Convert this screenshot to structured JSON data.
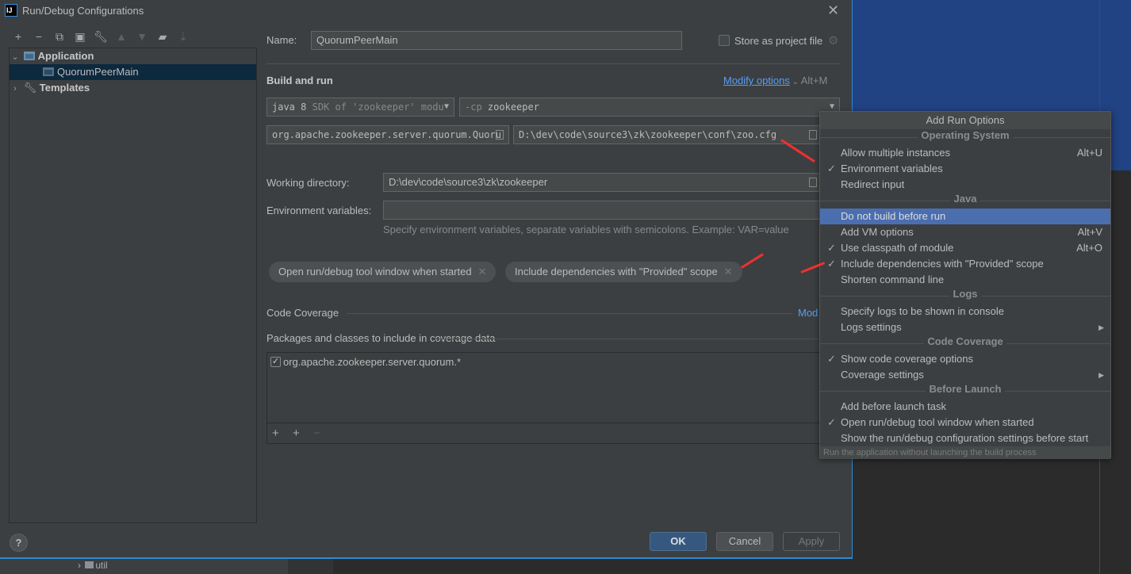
{
  "window": {
    "title": "Run/Debug Configurations",
    "logo": "IJ"
  },
  "toolbar": {
    "icons": [
      "plus-icon",
      "minus-icon",
      "copy-icon",
      "save-icon",
      "wrench-icon",
      "arrow-up-icon",
      "arrow-down-icon",
      "new-folder-icon",
      "sort-icon"
    ]
  },
  "tree": {
    "items": [
      {
        "label": "Application",
        "expanded": true
      },
      {
        "label": "QuorumPeerMain",
        "selected": true
      },
      {
        "label": "Templates",
        "expanded": false
      }
    ]
  },
  "form": {
    "name_label": "Name:",
    "name_value": "QuorumPeerMain",
    "store_label": "Store as project file",
    "store_checked": false,
    "build_title": "Build and run",
    "modify_options": "Modify options",
    "modify_shortcut": "Alt+M",
    "jre": "java 8",
    "jre_hint": "SDK of 'zookeeper' modu",
    "cp_prefix": "-cp",
    "cp_value": "zookeeper",
    "main_class": "org.apache.zookeeper.server.quorum.Quoru",
    "program_args": "D:\\dev\\code\\source3\\zk\\zookeeper\\conf\\zoo.cfg",
    "workdir_label": "Working directory:",
    "workdir_value": "D:\\dev\\code\\source3\\zk\\zookeeper",
    "env_label": "Environment variables:",
    "env_value": "",
    "env_hint": "Specify environment variables, separate variables with semicolons. Example: VAR=value",
    "chips": [
      "Open run/debug tool window when started",
      "Include dependencies with \"Provided\" scope"
    ],
    "coverage_title": "Code Coverage",
    "coverage_modify": "Mod",
    "coverage_packages_label": "Packages and classes to include in coverage data",
    "coverage_entry": "org.apache.zookeeper.server.quorum.*",
    "coverage_entry_checked": true
  },
  "buttons": {
    "ok": "OK",
    "cancel": "Cancel",
    "apply": "Apply",
    "help": "?"
  },
  "background": {
    "tree_item": "util",
    "blue": "#214283"
  },
  "menu": {
    "title": "Add Run Options",
    "sections": [
      {
        "title": "Operating System",
        "items": [
          {
            "label": "Allow multiple instances",
            "shortcut": "Alt+U"
          },
          {
            "label": "Environment variables",
            "checked": true
          },
          {
            "label": "Redirect input"
          }
        ]
      },
      {
        "title": "Java",
        "items": [
          {
            "label": "Do not build before run",
            "highlighted": true
          },
          {
            "label": "Add VM options",
            "shortcut": "Alt+V"
          },
          {
            "label": "Use classpath of module",
            "checked": true,
            "shortcut": "Alt+O"
          },
          {
            "label": "Include dependencies with \"Provided\" scope",
            "checked": true
          },
          {
            "label": "Shorten command line"
          }
        ]
      },
      {
        "title": "Logs",
        "items": [
          {
            "label": "Specify logs to be shown in console"
          },
          {
            "label": "Logs settings",
            "submenu": true
          }
        ]
      },
      {
        "title": "Code Coverage",
        "items": [
          {
            "label": "Show code coverage options",
            "checked": true
          },
          {
            "label": "Coverage settings",
            "submenu": true
          }
        ]
      },
      {
        "title": "Before Launch",
        "items": [
          {
            "label": "Add before launch task"
          },
          {
            "label": "Open run/debug tool window when started",
            "checked": true
          },
          {
            "label": "Show the run/debug configuration settings before start"
          }
        ]
      }
    ],
    "footer": "Run the application without launching the build process"
  }
}
